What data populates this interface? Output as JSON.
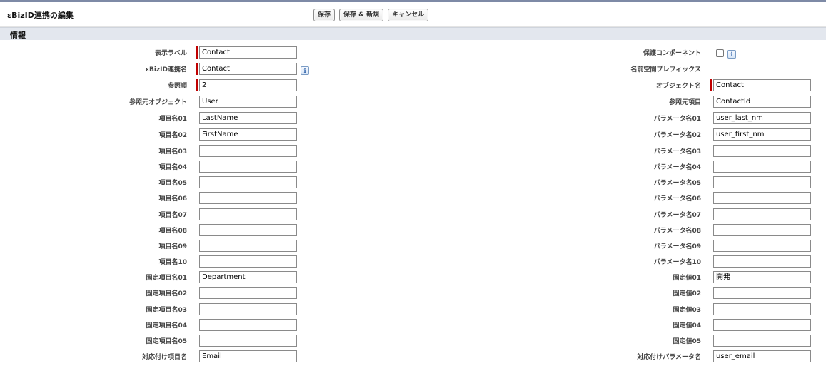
{
  "page": {
    "title": "εBizID連携の編集",
    "buttons": {
      "save": "保存",
      "save_new": "保存 & 新規",
      "cancel": "キャンセル"
    }
  },
  "section": {
    "title": "情報"
  },
  "fields": {
    "display_label": {
      "label": "表示ラベル",
      "value": "Contact"
    },
    "protected_component": {
      "label": "保護コンポーネント",
      "checked": false
    },
    "link_name": {
      "label": "εBizID連携名",
      "value": "Contact"
    },
    "namespace_prefix": {
      "label": "名前空間プレフィックス"
    },
    "reference_order": {
      "label": "参照順",
      "value": "2"
    },
    "object_name": {
      "label": "オブジェクト名",
      "value": "Contact"
    },
    "source_object": {
      "label": "参照元オブジェクト",
      "value": "User"
    },
    "source_field": {
      "label": "参照元項目",
      "value": "ContactId"
    },
    "item_rows": [
      {
        "label": "項目名01",
        "value": "LastName",
        "param_label": "パラメータ名01",
        "param_value": "user_last_nm"
      },
      {
        "label": "項目名02",
        "value": "FirstName",
        "param_label": "パラメータ名02",
        "param_value": "user_first_nm"
      },
      {
        "label": "項目名03",
        "value": "",
        "param_label": "パラメータ名03",
        "param_value": ""
      },
      {
        "label": "項目名04",
        "value": "",
        "param_label": "パラメータ名04",
        "param_value": ""
      },
      {
        "label": "項目名05",
        "value": "",
        "param_label": "パラメータ名05",
        "param_value": ""
      },
      {
        "label": "項目名06",
        "value": "",
        "param_label": "パラメータ名06",
        "param_value": ""
      },
      {
        "label": "項目名07",
        "value": "",
        "param_label": "パラメータ名07",
        "param_value": ""
      },
      {
        "label": "項目名08",
        "value": "",
        "param_label": "パラメータ名08",
        "param_value": ""
      },
      {
        "label": "項目名09",
        "value": "",
        "param_label": "パラメータ名09",
        "param_value": ""
      },
      {
        "label": "項目名10",
        "value": "",
        "param_label": "パラメータ名10",
        "param_value": ""
      }
    ],
    "fixed_rows": [
      {
        "label": "固定項目名01",
        "value": "Department",
        "val_label": "固定値01",
        "val_value": "開発"
      },
      {
        "label": "固定項目名02",
        "value": "",
        "val_label": "固定値02",
        "val_value": ""
      },
      {
        "label": "固定項目名03",
        "value": "",
        "val_label": "固定値03",
        "val_value": ""
      },
      {
        "label": "固定項目名04",
        "value": "",
        "val_label": "固定値04",
        "val_value": ""
      },
      {
        "label": "固定項目名05",
        "value": "",
        "val_label": "固定値05",
        "val_value": ""
      }
    ],
    "mapping": {
      "label": "対応付け項目名",
      "value": "Email",
      "param_label": "対応付けパラメータ名",
      "param_value": "user_email"
    }
  },
  "icons": {
    "info": "info-icon",
    "info_glyph": "i"
  },
  "colors": {
    "required_bar": "#c00000",
    "section_bg": "#e3e7ee"
  }
}
